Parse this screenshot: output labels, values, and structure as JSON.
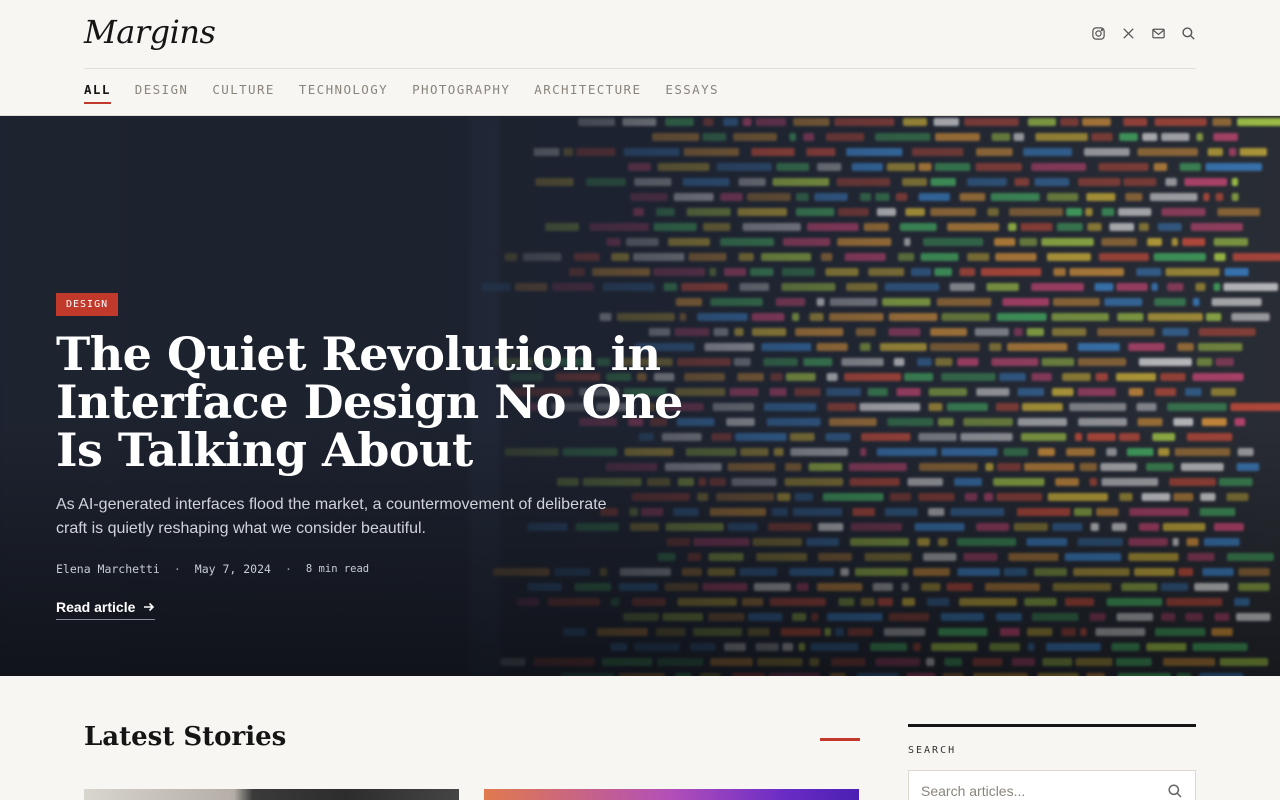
{
  "site": {
    "logo": "Margins"
  },
  "header": {
    "icons": [
      "instagram-icon",
      "x-icon",
      "mail-icon",
      "search-icon"
    ]
  },
  "nav": {
    "items": [
      "ALL",
      "DESIGN",
      "CULTURE",
      "TECHNOLOGY",
      "PHOTOGRAPHY",
      "ARCHITECTURE",
      "ESSAYS"
    ],
    "active": "ALL"
  },
  "hero": {
    "category": "DESIGN",
    "title": "The Quiet Revolution in Interface Design No One Is Talking About",
    "subtitle": "As AI-generated interfaces flood the market, a countermovement of deliberate craft is quietly reshaping what we consider beautiful.",
    "author": "Elena Marchetti",
    "date": "May 7, 2024",
    "read_time": "8 min read",
    "cta": "Read article"
  },
  "latest": {
    "title": "Latest Stories"
  },
  "sidebar": {
    "search_label": "SEARCH",
    "search_placeholder": "Search articles..."
  },
  "colors": {
    "accent": "#c0392b",
    "background": "#f8f6f2",
    "hero_dark": "#1c2230"
  }
}
